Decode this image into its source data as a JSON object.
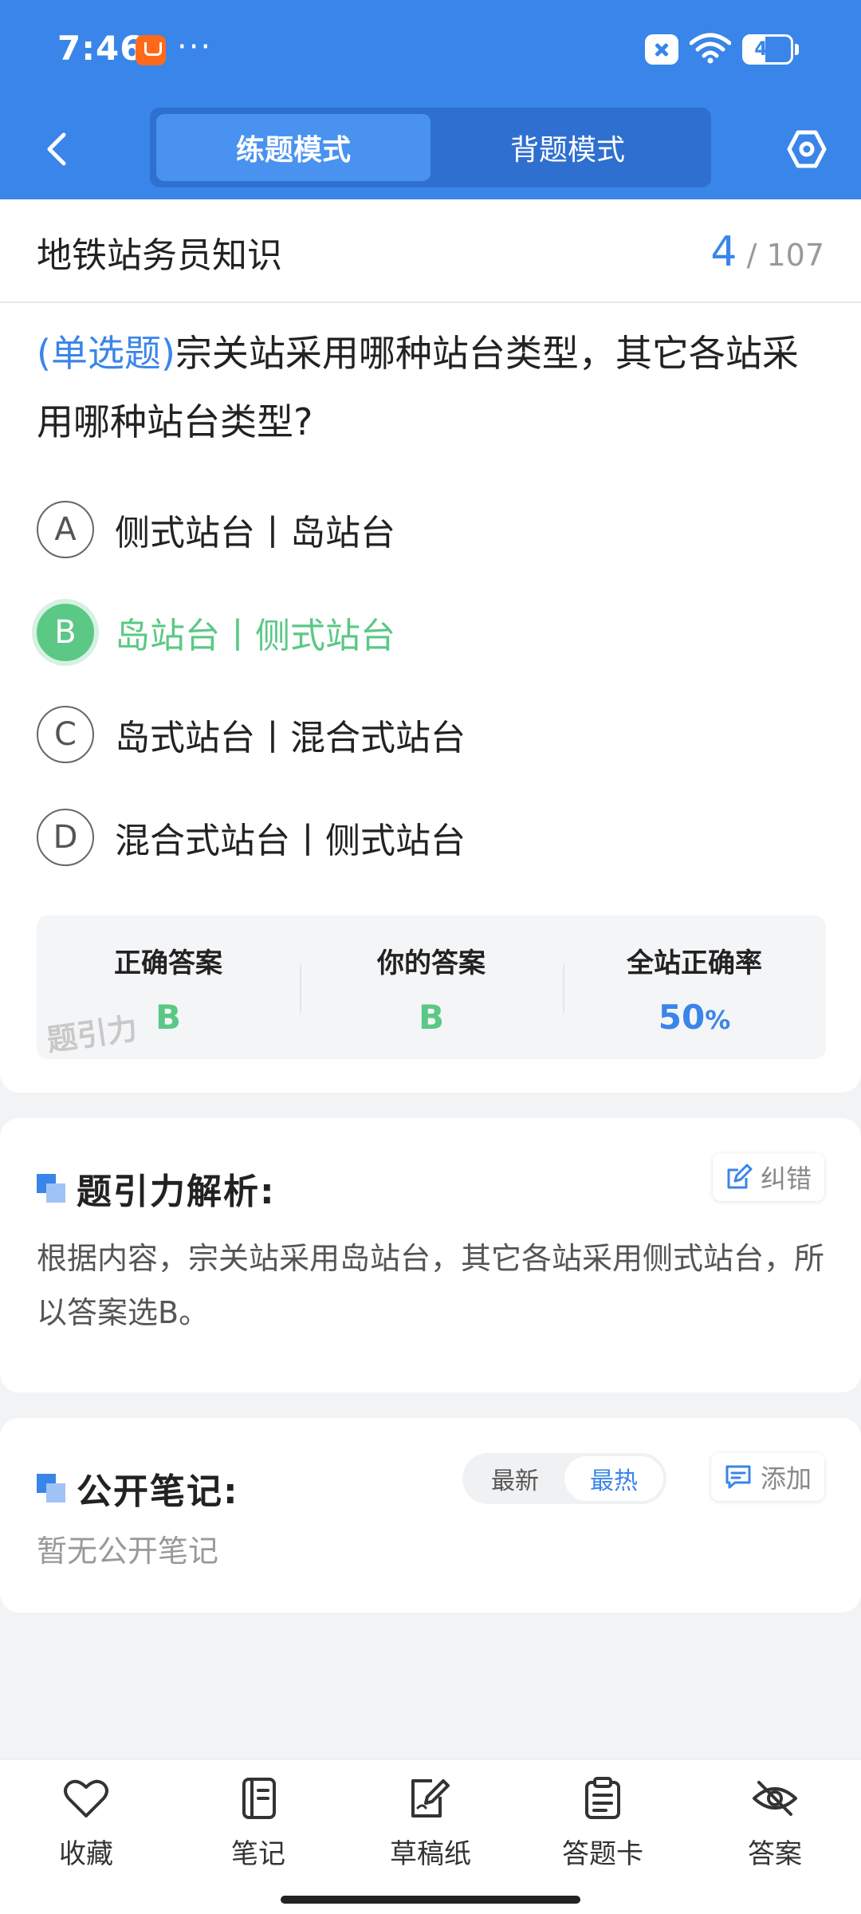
{
  "status_bar": {
    "time": "7:46",
    "dots": "···",
    "battery": "45",
    "icons": [
      "shopping-app-icon",
      "sim-off-icon",
      "wifi-icon",
      "battery-icon"
    ]
  },
  "nav": {
    "tabs": [
      {
        "label": "练题模式",
        "active": true
      },
      {
        "label": "背题模式",
        "active": false
      }
    ],
    "icons": [
      "back-arrow-icon",
      "settings-hexagon-icon"
    ]
  },
  "question": {
    "subject": "地铁站务员知识",
    "current": "4",
    "total": "/ 107",
    "type_label": "(单选题)",
    "text": "宗关站采用哪种站台类型，其它各站采用哪种站台类型?",
    "options": [
      {
        "key": "A",
        "text": "侧式站台丨岛站台",
        "state": "normal"
      },
      {
        "key": "B",
        "text": "岛站台丨侧式站台",
        "state": "correct"
      },
      {
        "key": "C",
        "text": "岛式站台丨混合式站台",
        "state": "normal"
      },
      {
        "key": "D",
        "text": "混合式站台丨侧式站台",
        "state": "normal"
      }
    ]
  },
  "answer_summary": {
    "correct_label": "正确答案",
    "correct_value": "B",
    "yours_label": "你的答案",
    "yours_value": "B",
    "rate_label": "全站正确率",
    "rate_value": "50",
    "rate_unit": "%",
    "watermark": "题引力"
  },
  "analysis": {
    "title": "题引力解析:",
    "report_button": "纠错",
    "text": "根据内容，宗关站采用岛站台，其它各站采用侧式站台，所以答案选B。"
  },
  "notes": {
    "title": "公开笔记:",
    "sort_options": [
      {
        "label": "最新",
        "active": false
      },
      {
        "label": "最热",
        "active": true
      }
    ],
    "add_button": "添加",
    "empty_text": "暂无公开笔记"
  },
  "toolbar": {
    "items": [
      {
        "label": "收藏",
        "icon": "heart-icon"
      },
      {
        "label": "笔记",
        "icon": "notebook-icon"
      },
      {
        "label": "草稿纸",
        "icon": "draft-pen-icon"
      },
      {
        "label": "答题卡",
        "icon": "clipboard-icon"
      },
      {
        "label": "答案",
        "icon": "eye-off-icon"
      }
    ]
  },
  "colors": {
    "primary": "#3a85e9",
    "correct": "#5bc885",
    "background": "#f2f3f5"
  }
}
